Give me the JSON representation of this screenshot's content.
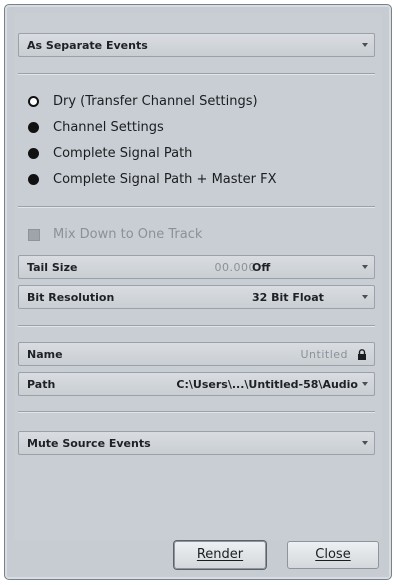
{
  "mode_dropdown": {
    "label": "As Separate Events"
  },
  "channel_options": [
    {
      "label": "Dry (Transfer Channel Settings)",
      "selected": true
    },
    {
      "label": "Channel Settings",
      "selected": false
    },
    {
      "label": "Complete Signal Path",
      "selected": false
    },
    {
      "label": "Complete Signal Path + Master FX",
      "selected": false
    }
  ],
  "mixdown": {
    "label": "Mix Down to One Track",
    "enabled": false,
    "checked": false
  },
  "tail_size": {
    "label": "Tail Size",
    "value": "00.000",
    "unit": "Off"
  },
  "bit_resolution": {
    "label": "Bit Resolution",
    "value": "32 Bit Float"
  },
  "name_field": {
    "label": "Name",
    "value": "Untitled"
  },
  "path_field": {
    "label": "Path",
    "value": "C:\\Users\\...\\Untitled-58\\Audio"
  },
  "source_events": {
    "label": "Mute Source Events"
  },
  "buttons": {
    "render": "Render",
    "close": "Close"
  },
  "colors": {
    "dialog_bg": "#c6ccd2",
    "field_bg": "#d3d8dc",
    "text": "#1e2226",
    "disabled_text": "#8b9197"
  }
}
